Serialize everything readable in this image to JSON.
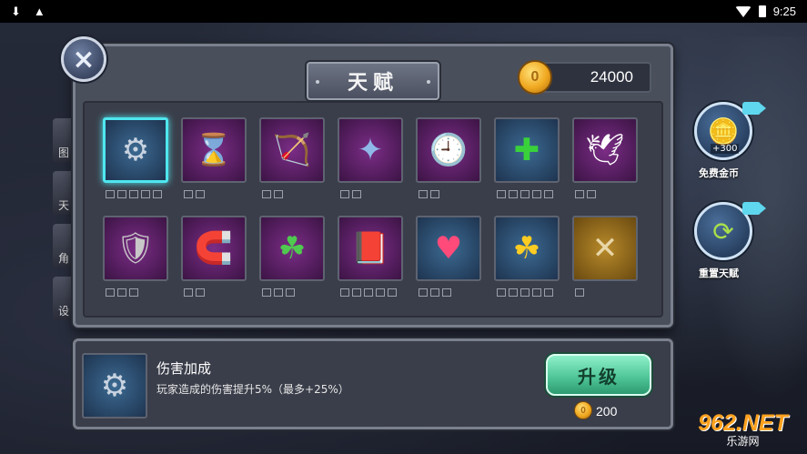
{
  "status_bar": {
    "time": "9:25",
    "icons": [
      "download-icon",
      "warning-icon",
      "wifi-icon",
      "battery-icon"
    ]
  },
  "side_menu": [
    "图",
    "天",
    "角",
    "设"
  ],
  "panel": {
    "title": "天赋",
    "coins": "24000",
    "close_icon": "×"
  },
  "talents": [
    {
      "icon": "brass-knuckles",
      "glyph": "⚙",
      "pips": 5,
      "selected": true,
      "bg": "blue"
    },
    {
      "icon": "hourglass",
      "glyph": "⌛",
      "pips": 2,
      "bg": "purple"
    },
    {
      "icon": "bow",
      "glyph": "🏹",
      "pips": 2,
      "bg": "purple"
    },
    {
      "icon": "shuriken",
      "glyph": "✦",
      "pips": 2,
      "bg": "purple"
    },
    {
      "icon": "pocket-watch",
      "glyph": "🕘",
      "pips": 2,
      "bg": "purple"
    },
    {
      "icon": "green-cross",
      "glyph": "✚",
      "pips": 5,
      "bg": "blue"
    },
    {
      "icon": "angel-wing",
      "glyph": "🕊",
      "pips": 2,
      "bg": "purple"
    },
    {
      "icon": "armor",
      "glyph": "🛡",
      "pips": 3,
      "bg": "purple"
    },
    {
      "icon": "magnet",
      "glyph": "🧲",
      "pips": 2,
      "bg": "purple"
    },
    {
      "icon": "clover",
      "glyph": "☘",
      "pips": 3,
      "bg": "purple"
    },
    {
      "icon": "book",
      "glyph": "📕",
      "pips": 5,
      "bg": "purple"
    },
    {
      "icon": "heart",
      "glyph": "♥",
      "pips": 3,
      "bg": "blue"
    },
    {
      "icon": "clover-coin",
      "glyph": "☘",
      "pips": 5,
      "bg": "blue"
    },
    {
      "icon": "crossed-arrows",
      "glyph": "✕",
      "pips": 1,
      "bg": "gold"
    }
  ],
  "right_buttons": {
    "free_coins_label": "免费金币",
    "free_coins_bonus": "+300",
    "reset_label": "重置天赋"
  },
  "detail": {
    "name": "伤害加成",
    "description": "玩家造成的伤害提升5%（最多+25%）",
    "upgrade_label": "升级",
    "cost": "200"
  },
  "watermark": {
    "main": "962.NET",
    "sub": "乐游网"
  },
  "colors": {
    "selected_border": "#4fe6ef",
    "upgrade_button": "#4cc395",
    "coin": "#f0a820"
  }
}
